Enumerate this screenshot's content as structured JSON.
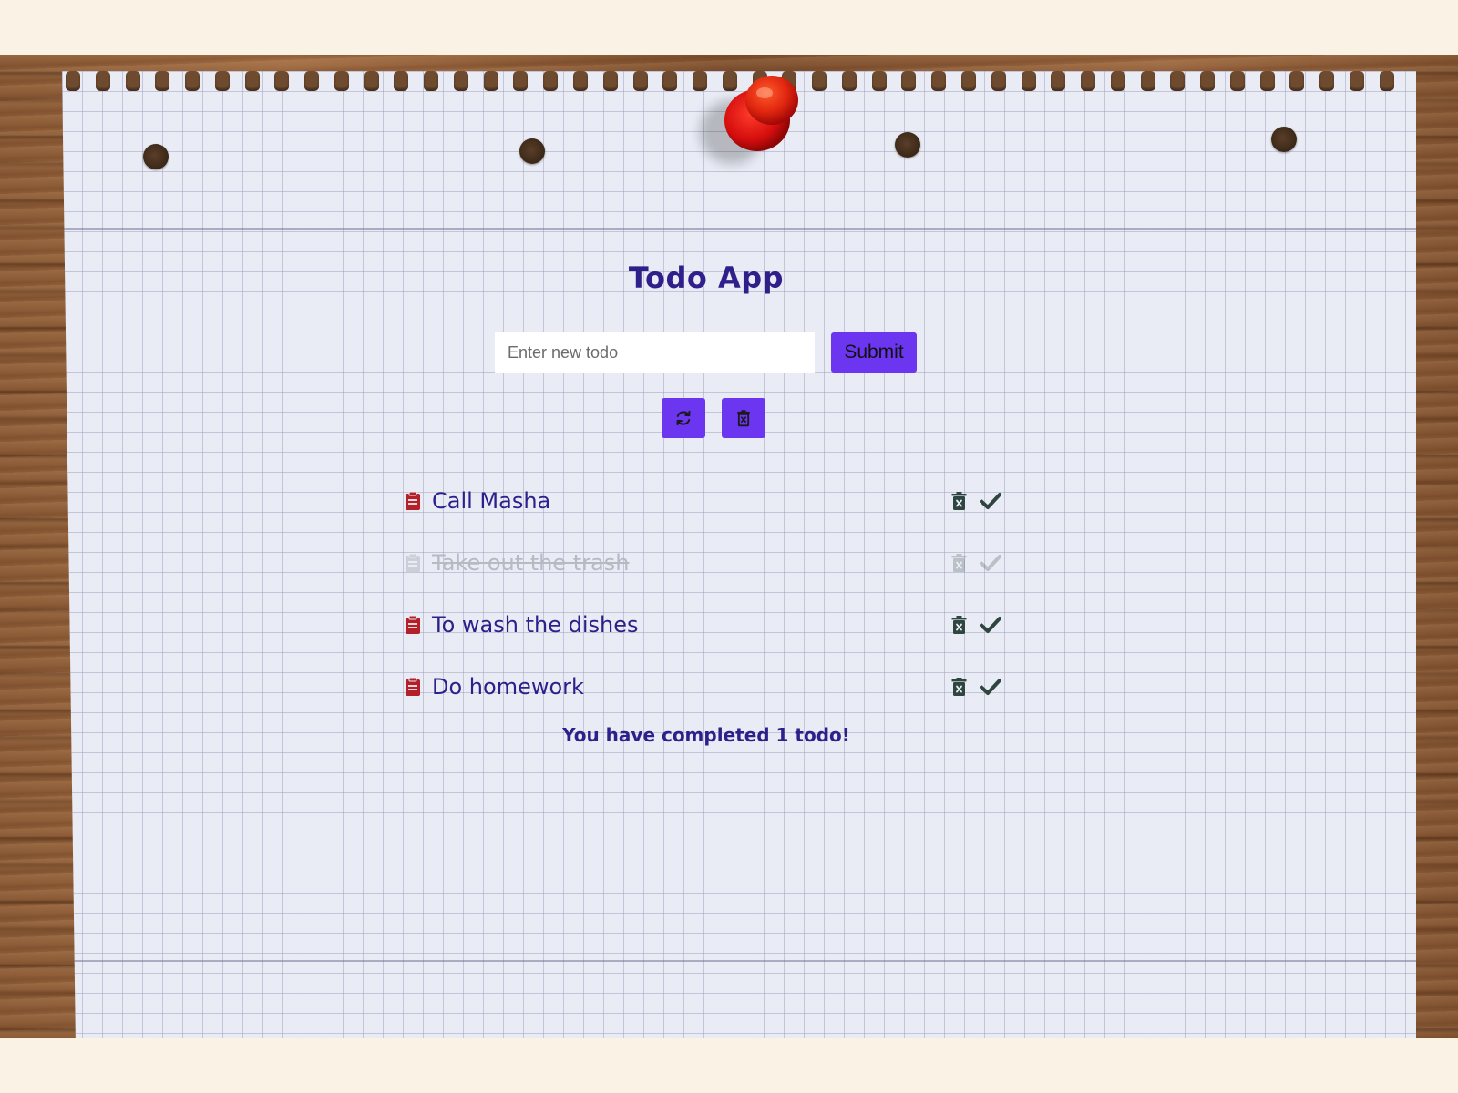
{
  "app": {
    "title": "Todo App"
  },
  "form": {
    "input_placeholder": "Enter new todo",
    "input_value": "",
    "submit_label": "Submit"
  },
  "actions": {
    "refresh_icon": "refresh-icon",
    "clear_all_icon": "trash-x-icon"
  },
  "todos": [
    {
      "text": "Call Masha",
      "completed": false
    },
    {
      "text": "Take out the trash",
      "completed": true
    },
    {
      "text": "To wash the dishes",
      "completed": false
    },
    {
      "text": "Do homework",
      "completed": false
    }
  ],
  "summary": {
    "text": "You have completed 1 todo!"
  },
  "colors": {
    "accent": "#6c35f0",
    "text": "#2e1f8a",
    "clipboard_icon": "#b3202a",
    "action_icon": "#2f4640",
    "completed_text": "#b9b9c4",
    "pin": "#d40d0d"
  }
}
